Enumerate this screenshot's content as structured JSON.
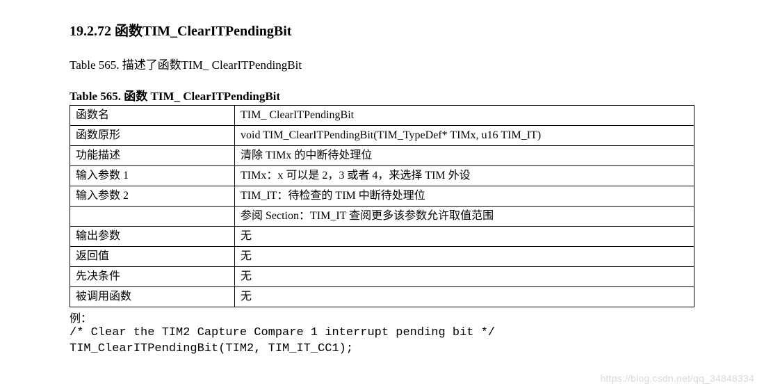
{
  "section": {
    "number": "19.2.72",
    "title": "函数TIM_ClearITPendingBit"
  },
  "description": "Table 565.  描述了函数TIM_ ClearITPendingBit",
  "table": {
    "caption": "Table 565.  函数 TIM_ ClearITPendingBit",
    "rows": [
      {
        "label": "函数名",
        "value": "TIM_ ClearITPendingBit"
      },
      {
        "label": "函数原形",
        "value": "void TIM_ClearITPendingBit(TIM_TypeDef* TIMx, u16 TIM_IT)"
      },
      {
        "label": "功能描述",
        "value": "清除 TIMx 的中断待处理位"
      },
      {
        "label": "输入参数 1",
        "value": "TIMx：x 可以是 2，3 或者 4，来选择 TIM 外设"
      },
      {
        "label": "输入参数 2",
        "value": "TIM_IT：待检查的 TIM 中断待处理位"
      },
      {
        "label": "",
        "value": "参阅 Section：TIM_IT 查阅更多该参数允许取值范围"
      },
      {
        "label": "输出参数",
        "value": "无"
      },
      {
        "label": "返回值",
        "value": "无"
      },
      {
        "label": "先决条件",
        "value": "无"
      },
      {
        "label": "被调用函数",
        "value": "无"
      }
    ]
  },
  "example": {
    "label": "例：",
    "code_line1": "/* Clear the TIM2 Capture Compare 1 interrupt pending bit */",
    "code_line2": "TIM_ClearITPendingBit(TIM2, TIM_IT_CC1);"
  },
  "watermark": "https://blog.csdn.net/qq_34848334"
}
